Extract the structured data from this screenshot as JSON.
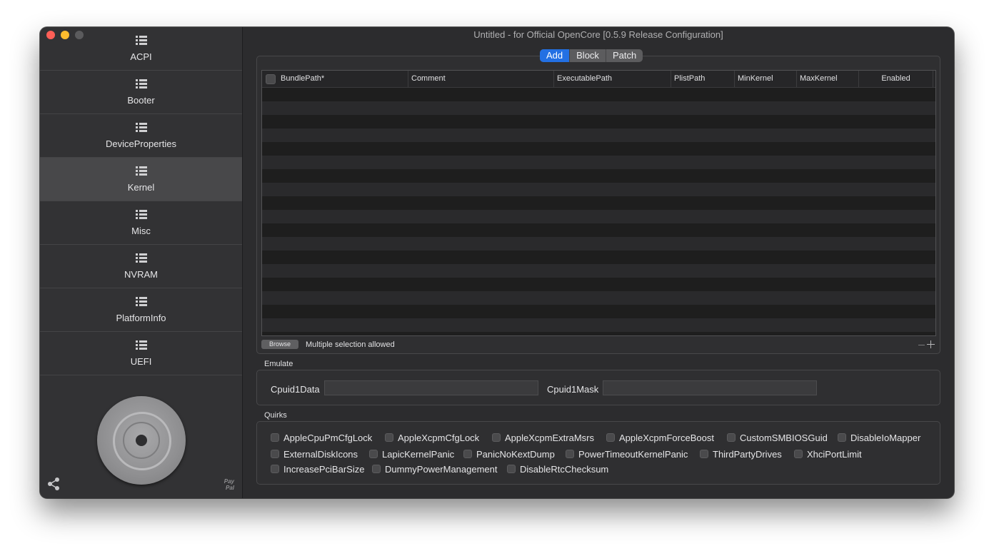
{
  "window": {
    "title": "Untitled - for Official OpenCore [0.5.9 Release Configuration]"
  },
  "sidebar": {
    "items": [
      {
        "label": "ACPI",
        "icon": "list-icon"
      },
      {
        "label": "Booter",
        "icon": "list-icon"
      },
      {
        "label": "DeviceProperties",
        "icon": "list-icon"
      },
      {
        "label": "Kernel",
        "icon": "list-icon",
        "active": true
      },
      {
        "label": "Misc",
        "icon": "list-icon"
      },
      {
        "label": "NVRAM",
        "icon": "list-icon"
      },
      {
        "label": "PlatformInfo",
        "icon": "list-icon"
      },
      {
        "label": "UEFI",
        "icon": "list-icon"
      }
    ],
    "paypal_label": "Pay Pal"
  },
  "tabs": {
    "items": [
      "Add",
      "Block",
      "Patch"
    ],
    "selected": "Add"
  },
  "table": {
    "columns": [
      "BundlePath*",
      "Comment",
      "ExecutablePath",
      "PlistPath",
      "MinKernel",
      "MaxKernel",
      "Enabled"
    ],
    "rows": []
  },
  "table_footer": {
    "browse_label": "Browse",
    "hint": "Multiple selection allowed"
  },
  "emulate": {
    "title": "Emulate",
    "cpuid1data_label": "Cpuid1Data",
    "cpuid1data_value": "",
    "cpuid1mask_label": "Cpuid1Mask",
    "cpuid1mask_value": ""
  },
  "quirks": {
    "title": "Quirks",
    "items": [
      "AppleCpuPmCfgLock",
      "AppleXcpmCfgLock",
      "AppleXcpmExtraMsrs",
      "AppleXcpmForceBoost",
      "CustomSMBIOSGuid",
      "DisableIoMapper",
      "ExternalDiskIcons",
      "LapicKernelPanic",
      "PanicNoKextDump",
      "PowerTimeoutKernelPanic",
      "ThirdPartyDrives",
      "XhciPortLimit",
      "IncreasePciBarSize",
      "DummyPowerManagement",
      "DisableRtcChecksum"
    ]
  },
  "colors": {
    "accent": "#2370e3",
    "close": "#fe5f57",
    "minimize": "#febc2e"
  }
}
